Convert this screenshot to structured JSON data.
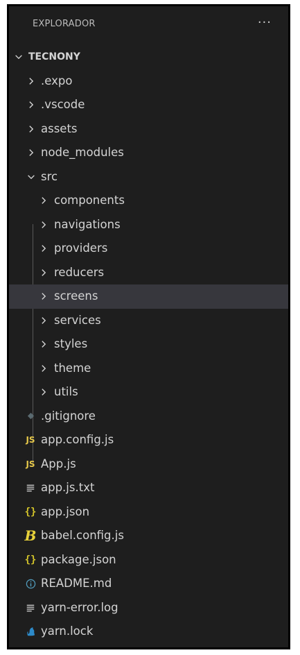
{
  "explorer": {
    "title": "EXPLORADOR",
    "more_label": "···"
  },
  "tree": {
    "root": {
      "label": "TECNONY",
      "expanded": true
    },
    "folders": [
      {
        "label": ".expo",
        "expanded": false
      },
      {
        "label": ".vscode",
        "expanded": false
      },
      {
        "label": "assets",
        "expanded": false
      },
      {
        "label": "node_modules",
        "expanded": false
      },
      {
        "label": "src",
        "expanded": true
      }
    ],
    "src_children": [
      {
        "label": "components",
        "expanded": false,
        "selected": false
      },
      {
        "label": "navigations",
        "expanded": false,
        "selected": false
      },
      {
        "label": "providers",
        "expanded": false,
        "selected": false
      },
      {
        "label": "reducers",
        "expanded": false,
        "selected": false
      },
      {
        "label": "screens",
        "expanded": false,
        "selected": true
      },
      {
        "label": "services",
        "expanded": false,
        "selected": false
      },
      {
        "label": "styles",
        "expanded": false,
        "selected": false
      },
      {
        "label": "theme",
        "expanded": false,
        "selected": false
      },
      {
        "label": "utils",
        "expanded": false,
        "selected": false
      }
    ],
    "files": [
      {
        "label": ".gitignore",
        "icon": "git-diamond-icon"
      },
      {
        "label": "app.config.js",
        "icon": "js-icon",
        "badge": "JS"
      },
      {
        "label": "App.js",
        "icon": "js-icon",
        "badge": "JS"
      },
      {
        "label": "app.js.txt",
        "icon": "text-lines-icon"
      },
      {
        "label": "app.json",
        "icon": "json-braces-icon",
        "badge": "{}"
      },
      {
        "label": "babel.config.js",
        "icon": "babel-icon",
        "badge": "B"
      },
      {
        "label": "package.json",
        "icon": "json-braces-icon",
        "badge": "{}"
      },
      {
        "label": "README.md",
        "icon": "info-circle-icon"
      },
      {
        "label": "yarn-error.log",
        "icon": "text-lines-icon"
      },
      {
        "label": "yarn.lock",
        "icon": "yarn-cat-icon"
      }
    ]
  },
  "colors": {
    "background": "#1e1e1e",
    "selected_row": "#37373d",
    "text": "#d4d4d4",
    "js_yellow": "#e6c84b",
    "json_yellow": "#d4c52a",
    "info_blue": "#519aba",
    "muted": "#6d8086",
    "yarn_blue": "#2d8ac9"
  }
}
